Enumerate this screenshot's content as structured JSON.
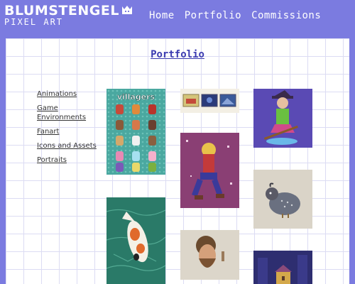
{
  "header": {
    "logo_title": "BLUMSTENGEL",
    "logo_subtitle": "PIXEL ART",
    "crown_icon": "crown-icon",
    "nav": [
      {
        "label": "Home"
      },
      {
        "label": "Portfolio"
      },
      {
        "label": "Commissions"
      }
    ]
  },
  "main": {
    "title": "Portfolio",
    "categories": [
      {
        "label": "Animations"
      },
      {
        "label": "Game Environments"
      },
      {
        "label": "Fanart"
      },
      {
        "label": "Icons and Assets"
      },
      {
        "label": "Portraits"
      }
    ],
    "villagers_title": "villagers"
  },
  "colors": {
    "background": "#7b7be0",
    "accent": "#3b3bb0",
    "panel": "#ffffff",
    "grid": "#dcdcf3"
  }
}
